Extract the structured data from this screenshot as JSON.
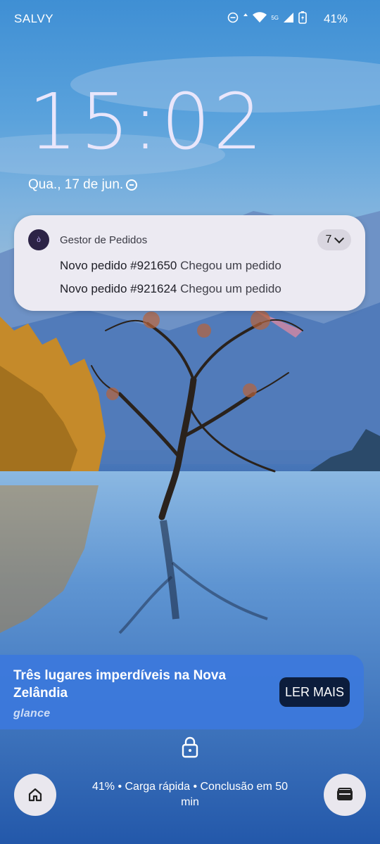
{
  "status_bar": {
    "carrier": "SALVY",
    "network": "5G",
    "battery": "41%"
  },
  "lockscreen": {
    "time": "15:02",
    "date": "Qua., 17 de jun."
  },
  "notification": {
    "app_name": "Gestor de Pedidos",
    "count": "7",
    "items": [
      {
        "title": "Novo pedido #921650",
        "body": "Chegou um pedido"
      },
      {
        "title": "Novo pedido #921624",
        "body": "Chegou um pedido"
      }
    ]
  },
  "glance": {
    "headline": "Três lugares imperdíveis na Nova Zelândia",
    "brand": "glance",
    "button_label": "LER MAIS"
  },
  "bottom": {
    "charging_text": "41% • Carga rápida • Conclusão em 50 min"
  },
  "colors": {
    "notification_bg": "#eceaf2",
    "app_icon_bg": "#2c2346",
    "glance_bg": "#3c78dc",
    "button_bg": "#0c1d3c"
  },
  "icons": [
    "dnd-icon",
    "data-arrows-icon",
    "wifi-icon",
    "signal-icon",
    "battery-charging-icon",
    "chevron-down-icon",
    "lock-icon",
    "home-icon",
    "wallet-icon"
  ]
}
